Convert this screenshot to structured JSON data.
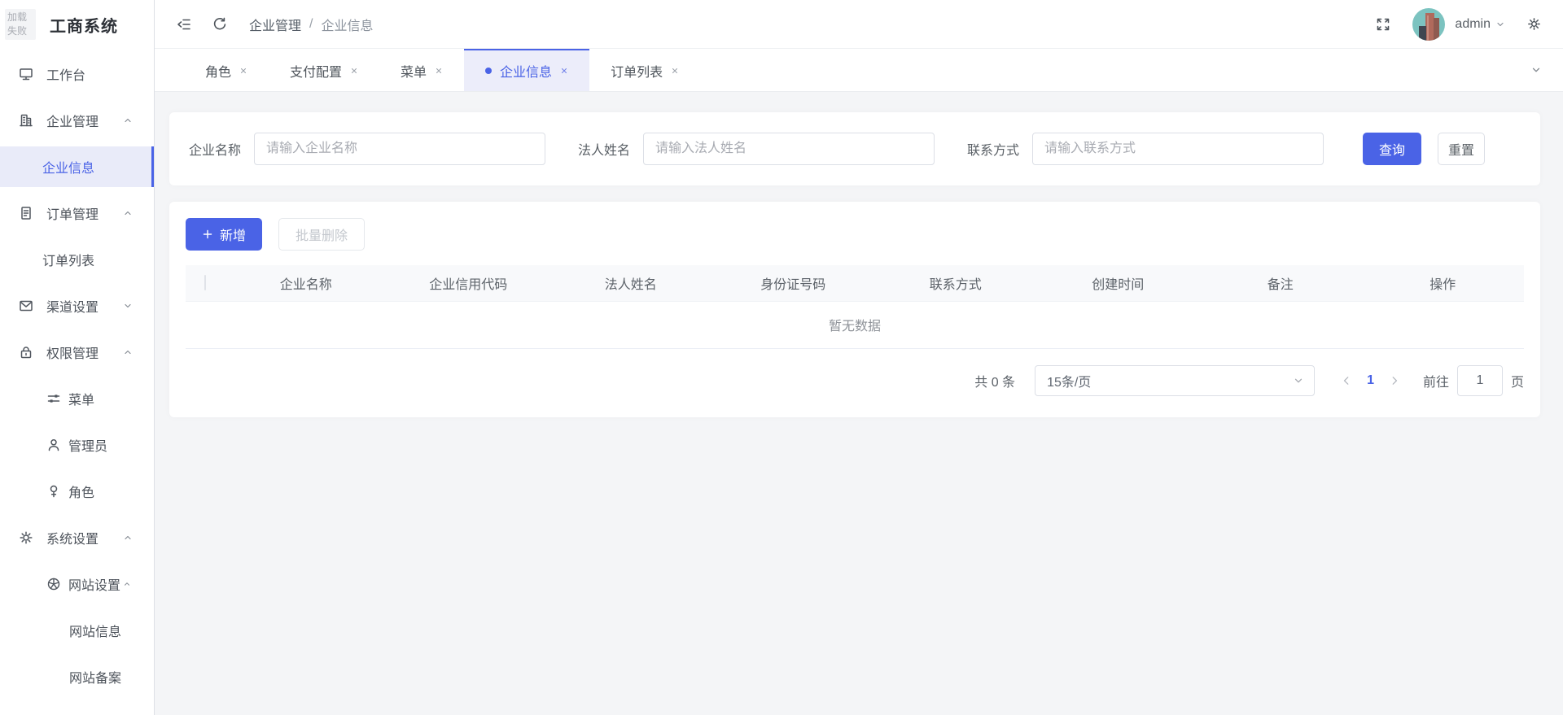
{
  "colors": {
    "primary": "#4a63e6",
    "active_bg": "#e9ebf9",
    "content_bg": "#f4f5f7"
  },
  "logo": {
    "placeholder_line1": "加载",
    "placeholder_line2": "失败",
    "title": "工商系统"
  },
  "navbar": {
    "breadcrumb": [
      "企业管理",
      "企业信息"
    ],
    "breadcrumb_separator": "/",
    "username": "admin",
    "icons": [
      "fold-icon",
      "refresh-icon",
      "fullscreen-icon",
      "avatar",
      "chevron-down-icon",
      "gear-icon"
    ]
  },
  "tabs": [
    {
      "label": "角色"
    },
    {
      "label": "支付配置"
    },
    {
      "label": "菜单"
    },
    {
      "label": "企业信息",
      "active": true
    },
    {
      "label": "订单列表"
    }
  ],
  "sidebar": {
    "items": [
      {
        "label": "工作台",
        "icon": "monitor"
      },
      {
        "label": "企业管理",
        "icon": "office-building",
        "expanded": true
      },
      {
        "label": "企业信息",
        "active": true
      },
      {
        "label": "订单管理",
        "icon": "document",
        "expanded": true
      },
      {
        "label": "订单列表"
      },
      {
        "label": "渠道设置",
        "icon": "envelope",
        "expanded": false
      },
      {
        "label": "权限管理",
        "icon": "lock",
        "expanded": true
      },
      {
        "label": "菜单",
        "icon": "sliders"
      },
      {
        "label": "管理员",
        "icon": "user"
      },
      {
        "label": "角色",
        "icon": "female"
      },
      {
        "label": "系统设置",
        "icon": "gear",
        "expanded": true
      },
      {
        "label": "网站设置",
        "icon": "pie-wheel",
        "expanded": true
      },
      {
        "label": "网站信息"
      },
      {
        "label": "网站备案"
      }
    ]
  },
  "search": {
    "fields": [
      {
        "label": "企业名称",
        "placeholder": "请输入企业名称"
      },
      {
        "label": "法人姓名",
        "placeholder": "请输入法人姓名"
      },
      {
        "label": "联系方式",
        "placeholder": "请输入联系方式"
      }
    ],
    "submit_label": "查询",
    "reset_label": "重置"
  },
  "toolbar": {
    "add_label": "新增",
    "batch_delete_label": "批量删除"
  },
  "table": {
    "headers": [
      "企业名称",
      "企业信用代码",
      "法人姓名",
      "身份证号码",
      "联系方式",
      "创建时间",
      "备注",
      "操作"
    ],
    "empty_text": "暂无数据"
  },
  "pagination": {
    "total_text": "共 0 条",
    "page_size_text": "15条/页",
    "current_page": "1",
    "goto_label": "前往",
    "goto_value": "1",
    "page_unit": "页"
  }
}
